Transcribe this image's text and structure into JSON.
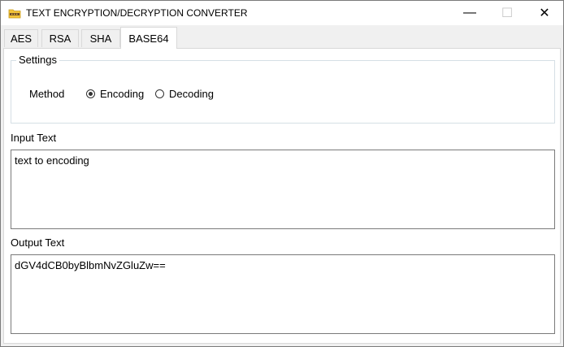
{
  "window": {
    "title": "TEXT ENCRYPTION/DECRYPTION CONVERTER",
    "app_icon": "folder-key-icon",
    "controls": {
      "minimize": "—",
      "maximize": "☐",
      "close": "✕"
    }
  },
  "tabs": [
    {
      "label": "AES",
      "active": false
    },
    {
      "label": "RSA",
      "active": false
    },
    {
      "label": "SHA",
      "active": false
    },
    {
      "label": "BASE64",
      "active": true
    }
  ],
  "settings": {
    "group_title": "Settings",
    "method_label": "Method",
    "options": [
      {
        "label": "Encoding",
        "selected": true
      },
      {
        "label": "Decoding",
        "selected": false
      }
    ]
  },
  "input": {
    "label": "Input Text",
    "value": "text to encoding"
  },
  "output": {
    "label": "Output Text",
    "value": "dGV4dCB0byBlbmNvZGluZw=="
  },
  "colors": {
    "icon_folder": "#f3c43a",
    "icon_band": "#6b4a2a"
  }
}
